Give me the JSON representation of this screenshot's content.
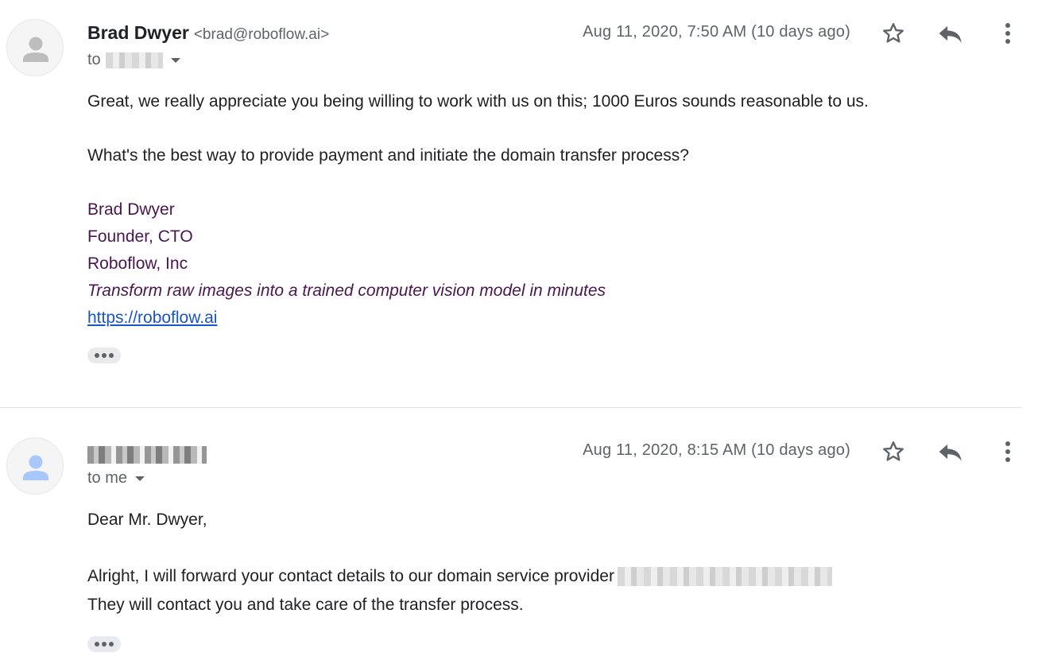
{
  "messages": [
    {
      "sender_name": "Brad Dwyer",
      "sender_email": "<brad@roboflow.ai>",
      "to_prefix": "to",
      "date": "Aug 11, 2020, 7:50 AM (10 days ago)",
      "body": [
        "Great, we really appreciate you being willing to work with us on this; 1000 Euros sounds reasonable to us.",
        "What's the best way to provide payment and initiate the domain transfer process?"
      ],
      "signature": {
        "name": "Brad Dwyer",
        "title": "Founder, CTO",
        "company": "Roboflow, Inc",
        "tagline": "Transform raw images into a trained computer vision model in minutes",
        "link": "https://roboflow.ai"
      },
      "avatar_color": "#bdbdbd"
    },
    {
      "to_label": "to me",
      "date": "Aug 11, 2020, 8:15 AM (10 days ago)",
      "body": [
        "Dear Mr. Dwyer,",
        "Alright, I will forward your contact details to our domain service provider",
        "They will contact you and take care of the transfer process."
      ],
      "avatar_color": "#a8c7fa"
    }
  ],
  "icons": {
    "star": "star-icon",
    "reply": "reply-icon",
    "more": "more-vert-icon",
    "expand": "show-trimmed-content-icon",
    "caret": "chevron-down-icon"
  },
  "colors": {
    "signature": "#4a1650",
    "link": "#1a55c7",
    "meta": "#5f6368"
  }
}
